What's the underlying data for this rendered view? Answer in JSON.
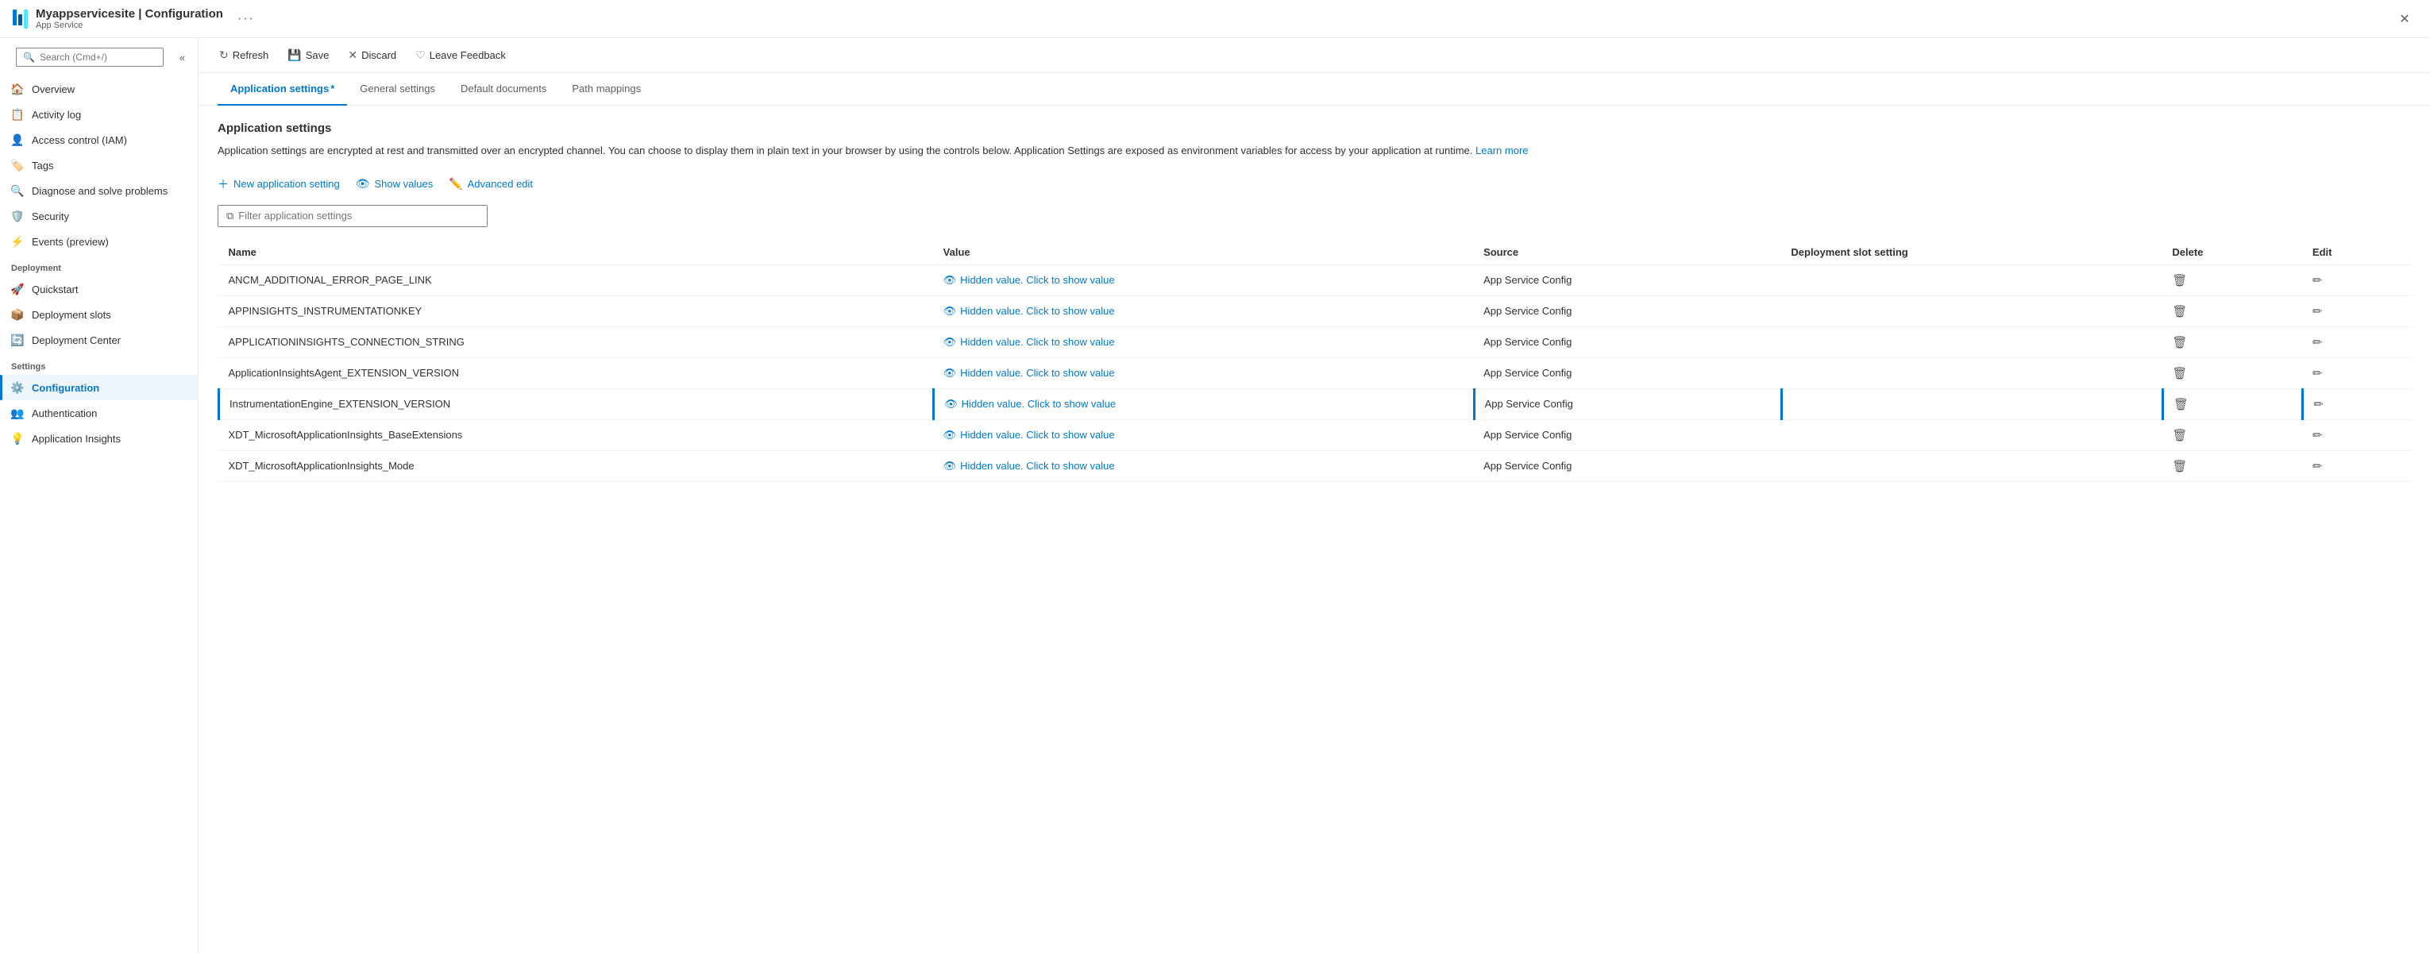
{
  "window": {
    "title": "Myappservicesite | Configuration",
    "subtitle": "App Service",
    "more_label": "···",
    "close_label": "✕"
  },
  "search": {
    "placeholder": "Search (Cmd+/)"
  },
  "toolbar": {
    "refresh_label": "Refresh",
    "save_label": "Save",
    "discard_label": "Discard",
    "feedback_label": "Leave Feedback"
  },
  "tabs": [
    {
      "id": "application-settings",
      "label": "Application settings",
      "active": true,
      "asterisk": true
    },
    {
      "id": "general-settings",
      "label": "General settings",
      "active": false
    },
    {
      "id": "default-documents",
      "label": "Default documents",
      "active": false
    },
    {
      "id": "path-mappings",
      "label": "Path mappings",
      "active": false
    }
  ],
  "section": {
    "title": "Application settings",
    "description": "Application settings are encrypted at rest and transmitted over an encrypted channel. You can choose to display them in plain text in your browser by using the controls below. Application Settings are exposed as environment variables for access by your application at runtime.",
    "learn_more_label": "Learn more",
    "learn_more_url": "#"
  },
  "actions": {
    "new_label": "New application setting",
    "show_values_label": "Show values",
    "advanced_edit_label": "Advanced edit"
  },
  "filter": {
    "placeholder": "Filter application settings"
  },
  "table": {
    "columns": [
      "Name",
      "Value",
      "Source",
      "Deployment slot setting",
      "Delete",
      "Edit"
    ],
    "rows": [
      {
        "name": "ANCM_ADDITIONAL_ERROR_PAGE_LINK",
        "value": "Hidden value. Click to show value",
        "source": "App Service Config",
        "deployment_slot": "",
        "highlighted": false
      },
      {
        "name": "APPINSIGHTS_INSTRUMENTATIONKEY",
        "value": "Hidden value. Click to show value",
        "source": "App Service Config",
        "deployment_slot": "",
        "highlighted": false
      },
      {
        "name": "APPLICATIONINSIGHTS_CONNECTION_STRING",
        "value": "Hidden value. Click to show value",
        "source": "App Service Config",
        "deployment_slot": "",
        "highlighted": false
      },
      {
        "name": "ApplicationInsightsAgent_EXTENSION_VERSION",
        "value": "Hidden value. Click to show value",
        "source": "App Service Config",
        "deployment_slot": "",
        "highlighted": false
      },
      {
        "name": "InstrumentationEngine_EXTENSION_VERSION",
        "value": "Hidden value. Click to show value",
        "source": "App Service Config",
        "deployment_slot": "",
        "highlighted": true
      },
      {
        "name": "XDT_MicrosoftApplicationInsights_BaseExtensions",
        "value": "Hidden value. Click to show value",
        "source": "App Service Config",
        "deployment_slot": "",
        "highlighted": false
      },
      {
        "name": "XDT_MicrosoftApplicationInsights_Mode",
        "value": "Hidden value. Click to show value",
        "source": "App Service Config",
        "deployment_slot": "",
        "highlighted": false
      }
    ]
  },
  "sidebar": {
    "nav_items": [
      {
        "id": "overview",
        "label": "Overview",
        "icon": "🏠",
        "section": null
      },
      {
        "id": "activity-log",
        "label": "Activity log",
        "icon": "📋",
        "section": null
      },
      {
        "id": "access-control",
        "label": "Access control (IAM)",
        "icon": "👤",
        "section": null
      },
      {
        "id": "tags",
        "label": "Tags",
        "icon": "🏷️",
        "section": null
      },
      {
        "id": "diagnose",
        "label": "Diagnose and solve problems",
        "icon": "🔍",
        "section": null
      },
      {
        "id": "security",
        "label": "Security",
        "icon": "🛡️",
        "section": null
      },
      {
        "id": "events",
        "label": "Events (preview)",
        "icon": "⚡",
        "section": null
      },
      {
        "id": "deployment-label",
        "label": "Deployment",
        "icon": null,
        "section": true
      },
      {
        "id": "quickstart",
        "label": "Quickstart",
        "icon": "🚀",
        "section": null
      },
      {
        "id": "deployment-slots",
        "label": "Deployment slots",
        "icon": "📦",
        "section": null
      },
      {
        "id": "deployment-center",
        "label": "Deployment Center",
        "icon": "🔄",
        "section": null
      },
      {
        "id": "settings-label",
        "label": "Settings",
        "icon": null,
        "section": true
      },
      {
        "id": "configuration",
        "label": "Configuration",
        "icon": "⚙️",
        "section": null,
        "active": true
      },
      {
        "id": "authentication",
        "label": "Authentication",
        "icon": "👥",
        "section": null
      },
      {
        "id": "application-insights",
        "label": "Application Insights",
        "icon": "💡",
        "section": null
      }
    ]
  }
}
